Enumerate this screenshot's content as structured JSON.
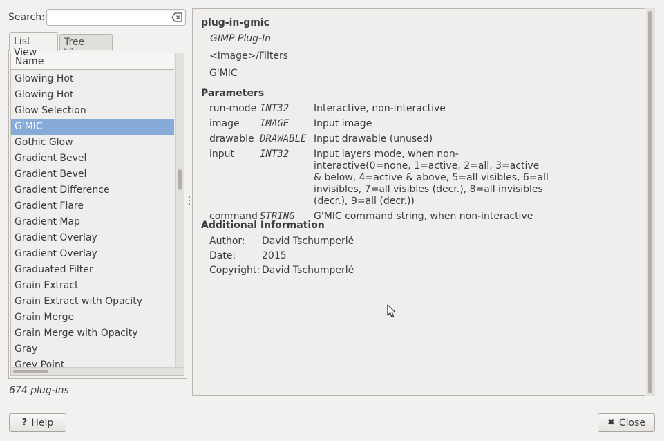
{
  "search": {
    "label": "Search:",
    "value": ""
  },
  "tabs": [
    {
      "label": "List View",
      "active": true
    },
    {
      "label": "Tree View",
      "active": false
    }
  ],
  "list": {
    "column_header": "Name",
    "rows": [
      "Glowing Hot",
      "Glowing Hot",
      "Glow Selection",
      "G'MIC",
      "Gothic Glow",
      "Gradient Bevel",
      "Gradient Bevel",
      "Gradient Difference",
      "Gradient Flare",
      "Gradient Map",
      "Gradient Overlay",
      "Gradient Overlay",
      "Graduated Filter",
      "Grain Extract",
      "Grain Extract with Opacity",
      "Grain Merge",
      "Grain Merge with Opacity",
      "Gray",
      "Grey Point"
    ],
    "selected_index": 3
  },
  "plugin_count": "674 plug-ins",
  "info": {
    "name": "plug-in-gmic",
    "type": "GIMP Plug-In",
    "menu_path": "<Image>/Filters",
    "menu_label": "G'MIC",
    "parameters_title": "Parameters",
    "parameters": [
      {
        "name": "run-mode",
        "type": "INT32",
        "desc": "Interactive, non-interactive"
      },
      {
        "name": "image",
        "type": "IMAGE",
        "desc": "Input image"
      },
      {
        "name": "drawable",
        "type": "DRAWABLE",
        "desc": "Input drawable (unused)"
      },
      {
        "name": "input",
        "type": "INT32",
        "desc": "Input layers mode, when non-interactive(0=none, 1=active, 2=all, 3=active & below, 4=active & above, 5=all visibles, 6=all invisibles, 7=all visibles (decr.), 8=all invisibles (decr.), 9=all (decr.))"
      },
      {
        "name": "command",
        "type": "STRING",
        "desc": "G'MIC command string, when non-interactive"
      }
    ],
    "additional_title": "Additional Information",
    "additional": [
      {
        "key": "Author:",
        "value": "David Tschumperlé"
      },
      {
        "key": "Date:",
        "value": "2015"
      },
      {
        "key": "Copyright:",
        "value": "David Tschumperlé"
      }
    ]
  },
  "buttons": {
    "help_label": "Help",
    "help_icon": "question-icon",
    "close_label": "Close",
    "close_icon": "close-x-icon"
  },
  "colors": {
    "selection": "#86abd9",
    "background": "#f2f1f0"
  }
}
